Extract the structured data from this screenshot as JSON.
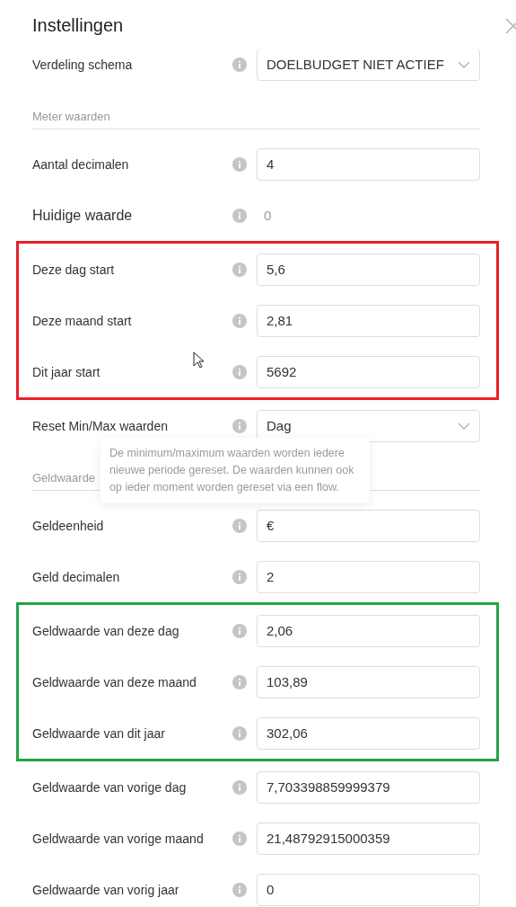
{
  "dialog": {
    "title": "Instellingen"
  },
  "items": [
    {
      "kind": "select",
      "label": "Verdeling schema",
      "value": "DOELBUDGET NIET ACTIEF"
    },
    {
      "kind": "section",
      "label": "Meter waarden"
    },
    {
      "kind": "input",
      "label": "Aantal decimalen",
      "value": "4"
    },
    {
      "kind": "readout",
      "label": "Huidige waarde",
      "value": "0"
    },
    {
      "kind": "group",
      "color": "#e8202a",
      "rows": [
        {
          "kind": "input",
          "label": "Deze dag start",
          "value": "5,6"
        },
        {
          "kind": "input",
          "label": "Deze maand start",
          "value": "2,81"
        },
        {
          "kind": "input",
          "label": "Dit jaar start",
          "value": "5692"
        }
      ]
    },
    {
      "kind": "select",
      "label": "Reset Min/Max waarden",
      "value": "Dag",
      "tooltip": "De minimum/maximum waarden worden iedere nieuwe periode gereset. De waarden kunnen ook op ieder moment worden gereset via een flow."
    },
    {
      "kind": "section",
      "label": "Geldwaarde"
    },
    {
      "kind": "input",
      "label": "Geldeenheid",
      "value": "€"
    },
    {
      "kind": "input",
      "label": "Geld decimalen",
      "value": "2"
    },
    {
      "kind": "group",
      "color": "#22a445",
      "rows": [
        {
          "kind": "input",
          "label": "Geldwaarde van deze dag",
          "value": "2,06"
        },
        {
          "kind": "input",
          "label": "Geldwaarde van deze maand",
          "value": "103,89"
        },
        {
          "kind": "input",
          "label": "Geldwaarde van dit jaar",
          "value": "302,06"
        }
      ]
    },
    {
      "kind": "input",
      "label": "Geldwaarde van vorige dag",
      "value": "7,703398859999379"
    },
    {
      "kind": "input",
      "label": "Geldwaarde van vorige maand",
      "value": "21,48792915000359"
    },
    {
      "kind": "input",
      "label": "Geldwaarde van vorig jaar",
      "value": "0"
    }
  ]
}
